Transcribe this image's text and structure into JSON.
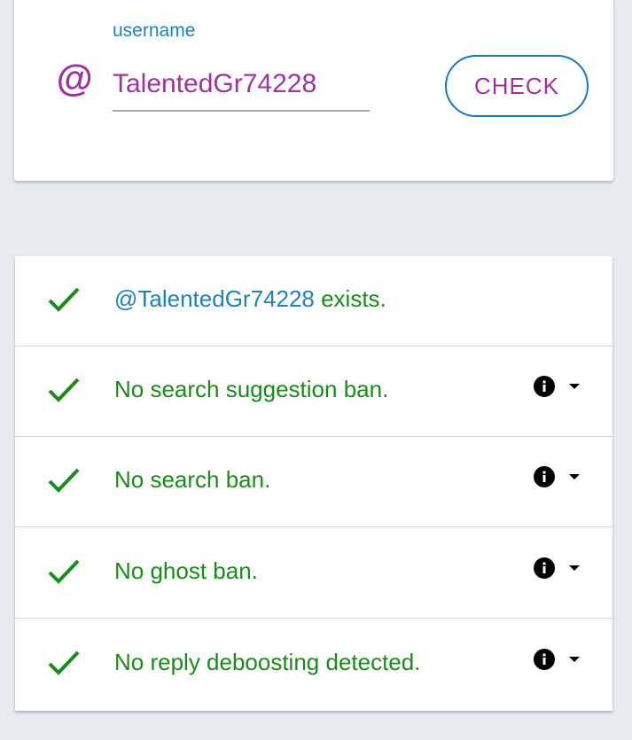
{
  "search": {
    "label": "username",
    "at_symbol": "@",
    "value": "TalentedGr74228",
    "button_label": "CHECK"
  },
  "results": [
    {
      "handle": "@TalentedGr74228",
      "text": " exists.",
      "status": "pass",
      "has_info": false
    },
    {
      "handle": "",
      "text": "No search suggestion ban.",
      "status": "pass",
      "has_info": true
    },
    {
      "handle": "",
      "text": "No search ban.",
      "status": "pass",
      "has_info": true
    },
    {
      "handle": "",
      "text": "No ghost ban.",
      "status": "pass",
      "has_info": true
    },
    {
      "handle": "",
      "text": "No reply deboosting detected.",
      "status": "pass",
      "has_info": true
    }
  ],
  "colors": {
    "accent_purple": "#a032a0",
    "accent_blue": "#1e82b4",
    "success_green": "#1a8a1a",
    "background": "#e6ebee"
  },
  "icons": {
    "status": "check-icon",
    "info": "info-icon",
    "expand": "caret-down-icon"
  }
}
